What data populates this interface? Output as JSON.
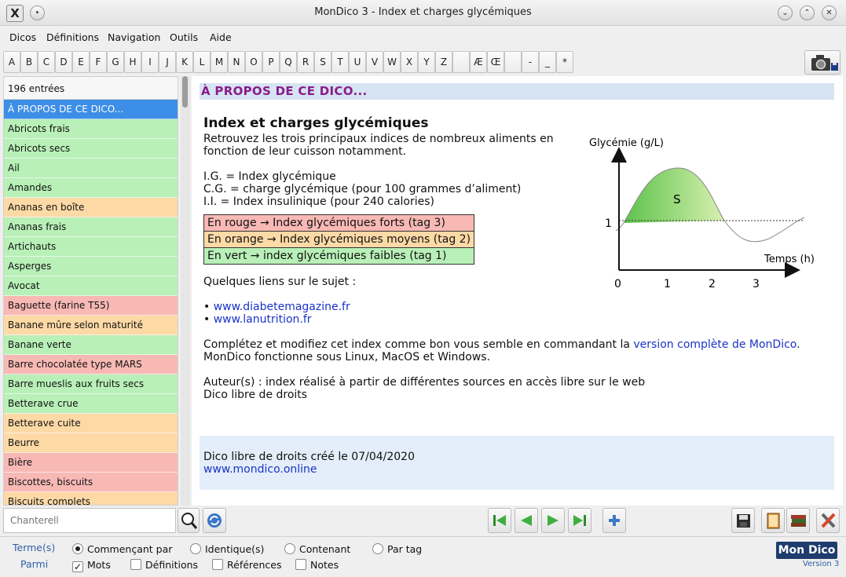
{
  "window": {
    "title": "MonDico 3 - Index et charges glycémiques",
    "app_icon_glyph": "X",
    "minimize_glyph": "⌄",
    "maximize_glyph": "⌃",
    "close_glyph": "✕",
    "extra_glyph": "•"
  },
  "menu": {
    "dicos": "Dicos",
    "definitions": "Définitions",
    "navigation": "Navigation",
    "outils": "Outils",
    "aide": "Aide"
  },
  "alphabet": [
    "A",
    "B",
    "C",
    "D",
    "E",
    "F",
    "G",
    "H",
    "I",
    "J",
    "K",
    "L",
    "M",
    "N",
    "O",
    "P",
    "Q",
    "R",
    "S",
    "T",
    "U",
    "V",
    "W",
    "X",
    "Y",
    "Z",
    "",
    "Æ",
    "Œ",
    "",
    "-",
    "_",
    "*"
  ],
  "sidebar": {
    "count": "196 entrées",
    "entries": [
      {
        "label": "À PROPOS DE CE DICO...",
        "tag": "selected"
      },
      {
        "label": "Abricots frais",
        "tag": "green"
      },
      {
        "label": "Abricots secs",
        "tag": "green"
      },
      {
        "label": "Ail",
        "tag": "green"
      },
      {
        "label": "Amandes",
        "tag": "green"
      },
      {
        "label": "Ananas en boîte",
        "tag": "orange"
      },
      {
        "label": "Ananas frais",
        "tag": "green"
      },
      {
        "label": "Artichauts",
        "tag": "green"
      },
      {
        "label": "Asperges",
        "tag": "green"
      },
      {
        "label": "Avocat",
        "tag": "green"
      },
      {
        "label": "Baguette (farine T55)",
        "tag": "red"
      },
      {
        "label": "Banane mûre selon maturité",
        "tag": "orange"
      },
      {
        "label": "Banane verte",
        "tag": "green"
      },
      {
        "label": "Barre chocolatée type MARS",
        "tag": "red"
      },
      {
        "label": "Barre mueslis aux fruits secs",
        "tag": "green"
      },
      {
        "label": "Betterave crue",
        "tag": "green"
      },
      {
        "label": "Betterave cuite",
        "tag": "orange"
      },
      {
        "label": "Beurre",
        "tag": "orange"
      },
      {
        "label": "Bière",
        "tag": "red"
      },
      {
        "label": "Biscottes, biscuits",
        "tag": "red"
      },
      {
        "label": "Biscuits complets",
        "tag": "orange"
      }
    ]
  },
  "content": {
    "banner": "À PROPOS DE CE DICO...",
    "heading": "Index et charges glycémiques",
    "intro_1": "Retrouvez les trois principaux indices de nombreux aliments en",
    "intro_2": "fonction de leur cuisson notamment.",
    "ig": "I.G. = Index glycémique",
    "cg": "C.G. = charge glycémique (pour 100 grammes d’aliment)",
    "ii": "I.I. = Index insulinique (pour 240 calories)",
    "legend_red": "En rouge → Index glycémiques forts (tag 3)",
    "legend_orange": "En orange → Index glycémiques moyens (tag 2)",
    "legend_green": "En vert → index glycémiques faibles (tag 1)",
    "links_intro": "Quelques liens sur le sujet :",
    "link_1": "www.diabetemagazine.fr",
    "link_2": "www.lanutrition.fr",
    "complete_pre": "Complétez et modifiez cet index comme bon vous semble en commandant la ",
    "complete_link": "version complète de MonDico",
    "complete_post": ".",
    "platforms": "MonDico fonctionne sous Linux, MacOS et Windows.",
    "authors": "Auteur(s) : index réalisé à partir de différentes sources en accès libre sur le web",
    "license": "Dico libre de droits",
    "footer_created": "Dico libre de droits créé le 07/04/2020",
    "footer_link": "www.mondico.online",
    "colors": {
      "red": "#f8b9b5",
      "orange": "#fdd9a6",
      "green": "#b8f0b8",
      "banner_text": "#8a1c8a",
      "link": "#1a33c7"
    }
  },
  "graph": {
    "y_label": "Glycémie (g/L)",
    "x_label": "Temps (h)",
    "area_label": "S",
    "y_tick": "1",
    "x_ticks": [
      "0",
      "1",
      "2",
      "3"
    ]
  },
  "bottombar": {
    "search_placeholder": "Chanterell",
    "search_icon": "magnifier-icon",
    "refresh_icon": "refresh-icon"
  },
  "options": {
    "terms_label": "Terme(s)",
    "among_label": "Parmi",
    "radio_starts": "Commençant par",
    "radio_identical": "Identique(s)",
    "radio_contains": "Contenant",
    "radio_tag": "Par tag",
    "check_words": "Mots",
    "check_definitions": "Définitions",
    "check_references": "Références",
    "check_notes": "Notes",
    "logo": "Mon Dico",
    "version": "Version 3"
  }
}
